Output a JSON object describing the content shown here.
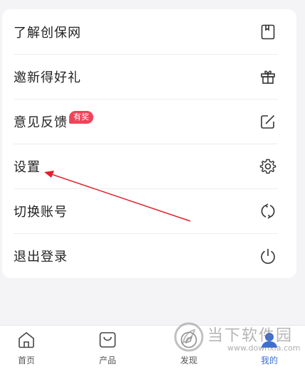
{
  "menu": {
    "items": [
      {
        "label": "了解创保网",
        "icon": "bookmark-icon"
      },
      {
        "label": "邀新得好礼",
        "icon": "gift-icon"
      },
      {
        "label": "意见反馈",
        "icon": "edit-icon",
        "badge": "有奖"
      },
      {
        "label": "设置",
        "icon": "gear-icon"
      },
      {
        "label": "切换账号",
        "icon": "switch-icon"
      },
      {
        "label": "退出登录",
        "icon": "power-icon"
      }
    ]
  },
  "tabs": [
    {
      "label": "首页",
      "icon": "home-icon"
    },
    {
      "label": "产品",
      "icon": "bag-icon"
    },
    {
      "label": "发现",
      "icon": "compass-icon"
    },
    {
      "label": "我的",
      "icon": "person-icon",
      "active": true
    }
  ],
  "watermark": {
    "text": "当下软件园",
    "url": "www.downxia.com"
  },
  "colors": {
    "badge": "#ef4458",
    "arrow": "#e0202a",
    "active_tab": "#3b6fd8"
  }
}
